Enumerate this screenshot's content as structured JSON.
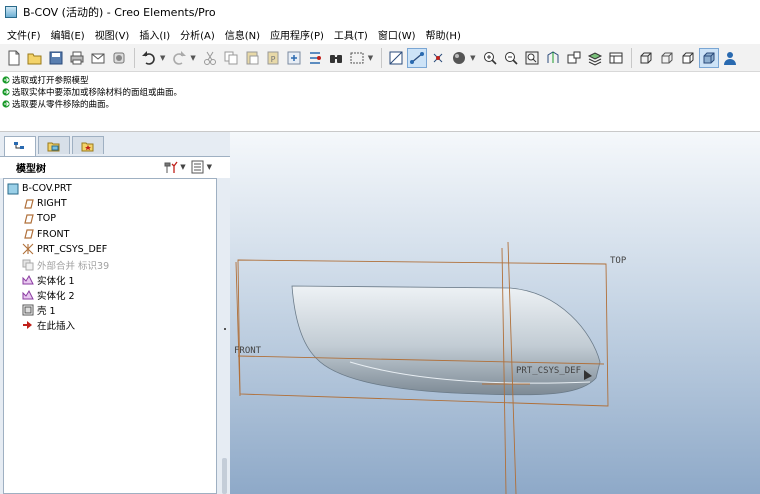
{
  "window": {
    "title": "B-COV (活动的) - Creo Elements/Pro"
  },
  "menu": [
    "文件(F)",
    "编辑(E)",
    "视图(V)",
    "插入(I)",
    "分析(A)",
    "信息(N)",
    "应用程序(P)",
    "工具(T)",
    "窗口(W)",
    "帮助(H)"
  ],
  "messages": [
    "选取或打开参照模型",
    "选取实体中要添加或移除材料的面组或曲面。",
    "选取要从零件移除的曲面。"
  ],
  "model_tree": {
    "header": "模型树",
    "items": [
      {
        "label": "B-COV.PRT",
        "icon": "part-icon"
      },
      {
        "label": "RIGHT",
        "icon": "datum-plane-icon"
      },
      {
        "label": "TOP",
        "icon": "datum-plane-icon"
      },
      {
        "label": "FRONT",
        "icon": "datum-plane-icon"
      },
      {
        "label": "PRT_CSYS_DEF",
        "icon": "csys-icon"
      },
      {
        "label": "外部合并 标识39",
        "icon": "merge-icon",
        "muted": true
      },
      {
        "label": "实体化 1",
        "icon": "solidify-icon"
      },
      {
        "label": "实体化 2",
        "icon": "solidify-icon"
      },
      {
        "label": "壳 1",
        "icon": "shell-icon"
      },
      {
        "label": "在此插入",
        "icon": "insert-here-icon"
      }
    ]
  },
  "viewport": {
    "label_top": "TOP",
    "label_front": "FRONT",
    "label_csys": "PRT_CSYS_DEF"
  },
  "colors": {
    "datum": "#b0703a",
    "accent": "#2a6ab0",
    "message_arrow": "#1a9a2a",
    "insert_marker": "#c0201a"
  }
}
